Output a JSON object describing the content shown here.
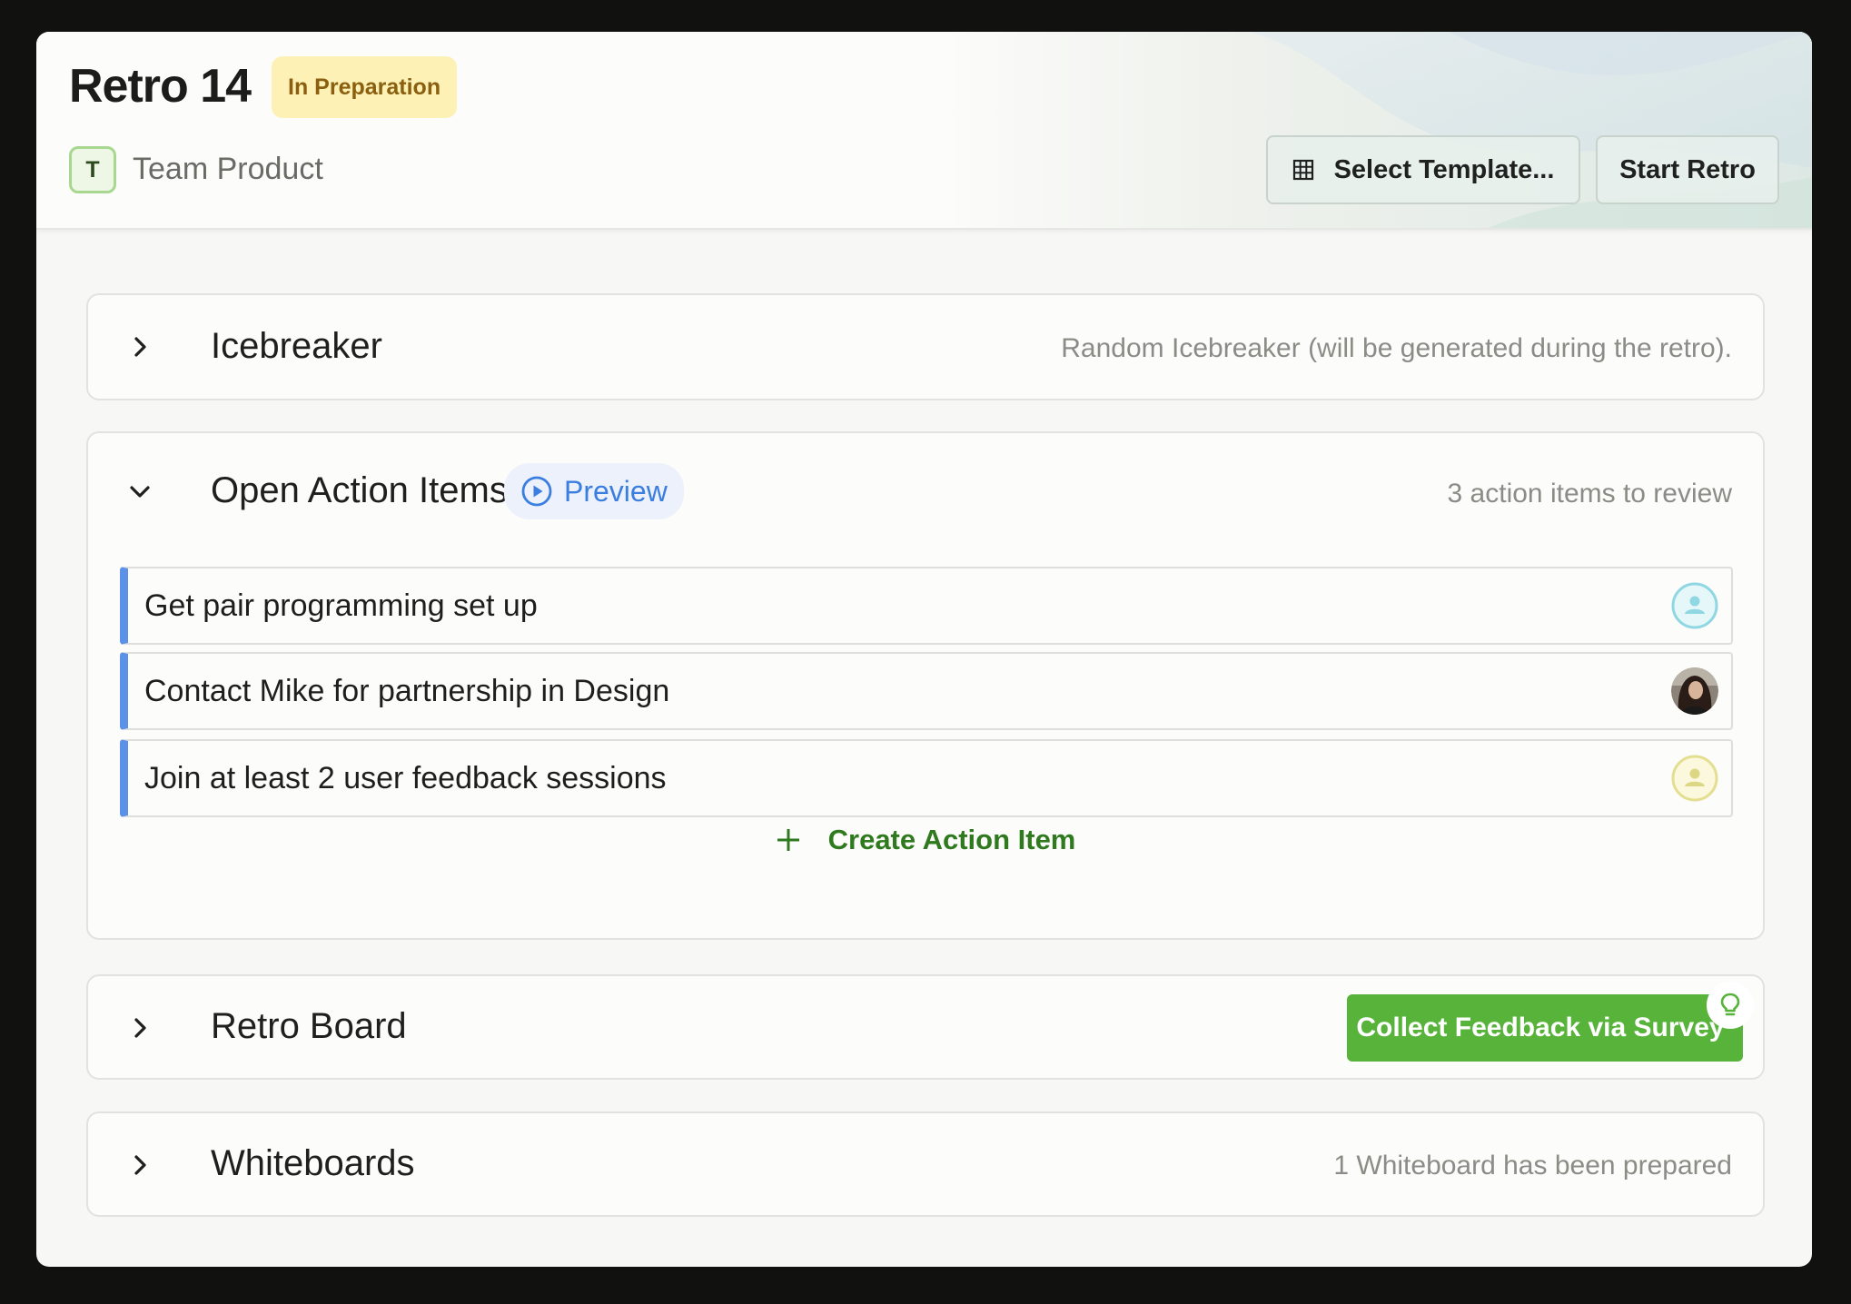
{
  "header": {
    "title": "Retro 14",
    "status": "In Preparation",
    "team_initial": "T",
    "team_name": "Team Product",
    "select_template_label": "Select Template...",
    "start_retro_label": "Start Retro"
  },
  "sections": {
    "icebreaker": {
      "title": "Icebreaker",
      "meta": "Random Icebreaker (will be generated during the retro)."
    },
    "open_action_items": {
      "title": "Open Action Items",
      "preview_label": "Preview",
      "meta": "3 action items to review",
      "items": [
        {
          "text": "Get pair programming set up",
          "assignee": "placeholder-avatar-teal"
        },
        {
          "text": "Contact Mike for partnership in Design",
          "assignee": "user-photo-avatar"
        },
        {
          "text": "Join at least 2 user feedback sessions",
          "assignee": "placeholder-avatar-yellow"
        }
      ],
      "create_label": "Create Action Item"
    },
    "retro_board": {
      "title": "Retro Board",
      "survey_label": "Collect Feedback via Survey"
    },
    "whiteboards": {
      "title": "Whiteboards",
      "meta": "1 Whiteboard has been prepared"
    }
  },
  "colors": {
    "status_badge_bg": "#fdf1b6",
    "accent_green": "#57b33a",
    "action_border_blue": "#5b91e8",
    "preview_blue": "#3a7fe0"
  }
}
